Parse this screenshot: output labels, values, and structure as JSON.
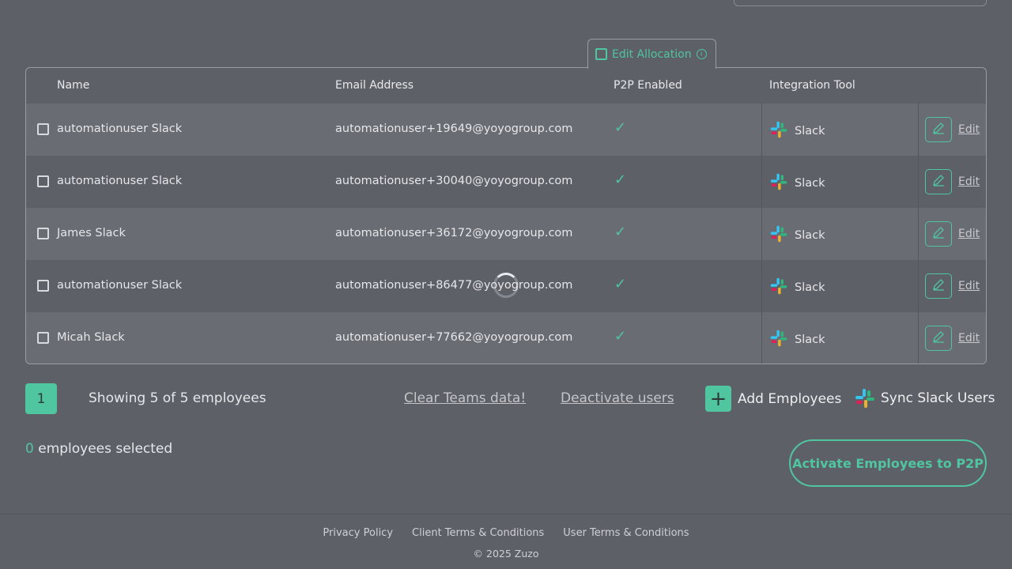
{
  "allocation_tab": {
    "label": "Edit Allocation",
    "info_icon": "info-icon"
  },
  "table": {
    "headers": {
      "name": "Name",
      "email": "Email Address",
      "p2p": "P2P Enabled",
      "tool": "Integration Tool"
    },
    "rows": [
      {
        "name": "automationuser Slack",
        "email": "automationuser+19649@yoyogroup.com",
        "p2p_enabled": true,
        "tool": "Slack",
        "edit_label": "Edit"
      },
      {
        "name": "automationuser Slack",
        "email": "automationuser+30040@yoyogroup.com",
        "p2p_enabled": true,
        "tool": "Slack",
        "edit_label": "Edit"
      },
      {
        "name": "James Slack",
        "email": "automationuser+36172@yoyogroup.com",
        "p2p_enabled": true,
        "tool": "Slack",
        "edit_label": "Edit"
      },
      {
        "name": "automationuser Slack",
        "email": "automationuser+86477@yoyogroup.com",
        "p2p_enabled": true,
        "tool": "Slack",
        "edit_label": "Edit"
      },
      {
        "name": "Micah Slack",
        "email": "automationuser+77662@yoyogroup.com",
        "p2p_enabled": true,
        "tool": "Slack",
        "edit_label": "Edit"
      }
    ]
  },
  "pagination": {
    "page": "1",
    "showing": "Showing 5 of 5 employees"
  },
  "actions": {
    "clear_teams": "Clear Teams data!",
    "deactivate": "Deactivate users",
    "add_employees": "Add Employees",
    "sync_slack": "Sync Slack Users",
    "activate": "Activate Employees to P2P"
  },
  "selection": {
    "count": "0",
    "label": " employees selected"
  },
  "footer": {
    "links": [
      "Privacy Policy",
      "Client Terms & Conditions",
      "User Terms & Conditions"
    ],
    "copyright": "© 2025 Zuzo"
  },
  "colors": {
    "accent": "#4fc5a0",
    "background": "#5e6068"
  }
}
